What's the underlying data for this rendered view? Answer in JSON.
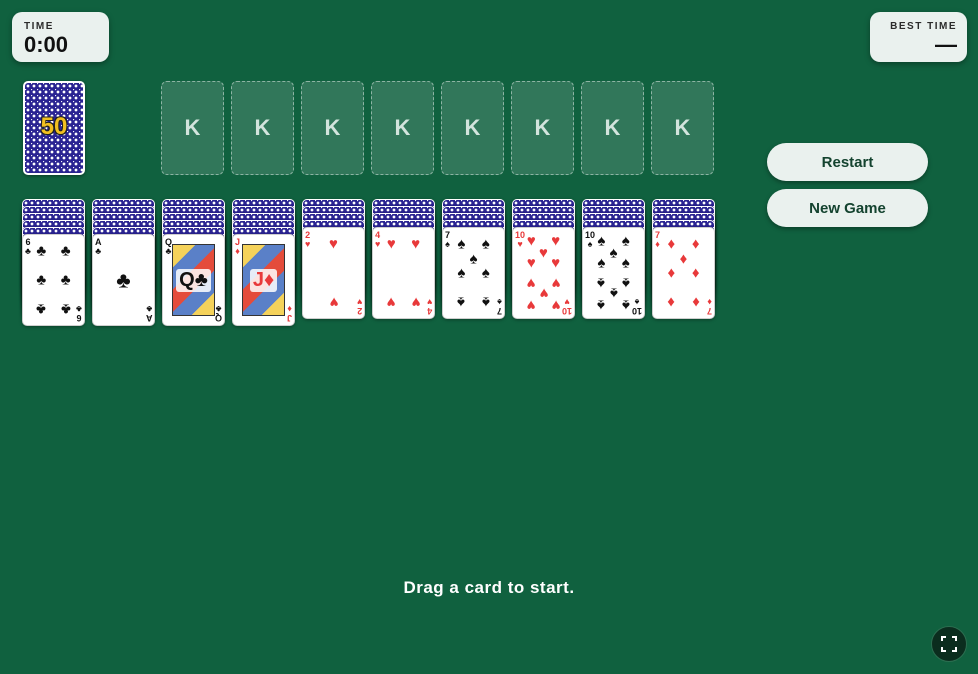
{
  "timer": {
    "label": "TIME",
    "value": "0:00"
  },
  "best_time": {
    "label": "BEST TIME",
    "value": "—"
  },
  "stock": {
    "count": "50"
  },
  "foundations": [
    "K",
    "K",
    "K",
    "K",
    "K",
    "K",
    "K",
    "K"
  ],
  "buttons": {
    "restart": "Restart",
    "new_game": "New Game"
  },
  "hint": "Drag a card to start.",
  "colors": {
    "table": "#10613f",
    "panel": "#eaf1ee",
    "card_back": "#2a2392",
    "red_suit": "#e8393a"
  },
  "icons": {
    "fullscreen": "fullscreen-icon"
  },
  "tableau": [
    {
      "hidden": 5,
      "top": {
        "rank": "6",
        "suit": "♣",
        "color": "black"
      }
    },
    {
      "hidden": 5,
      "top": {
        "rank": "A",
        "suit": "♣",
        "color": "black"
      }
    },
    {
      "hidden": 5,
      "top": {
        "rank": "Q",
        "suit": "♣",
        "color": "black"
      }
    },
    {
      "hidden": 5,
      "top": {
        "rank": "J",
        "suit": "♦",
        "color": "red"
      }
    },
    {
      "hidden": 4,
      "top": {
        "rank": "2",
        "suit": "♥",
        "color": "red"
      }
    },
    {
      "hidden": 4,
      "top": {
        "rank": "4",
        "suit": "♥",
        "color": "red"
      }
    },
    {
      "hidden": 4,
      "top": {
        "rank": "7",
        "suit": "♠",
        "color": "black"
      }
    },
    {
      "hidden": 4,
      "top": {
        "rank": "10",
        "suit": "♥",
        "color": "red"
      }
    },
    {
      "hidden": 4,
      "top": {
        "rank": "10",
        "suit": "♠",
        "color": "black"
      }
    },
    {
      "hidden": 4,
      "top": {
        "rank": "7",
        "suit": "♦",
        "color": "red"
      }
    }
  ]
}
